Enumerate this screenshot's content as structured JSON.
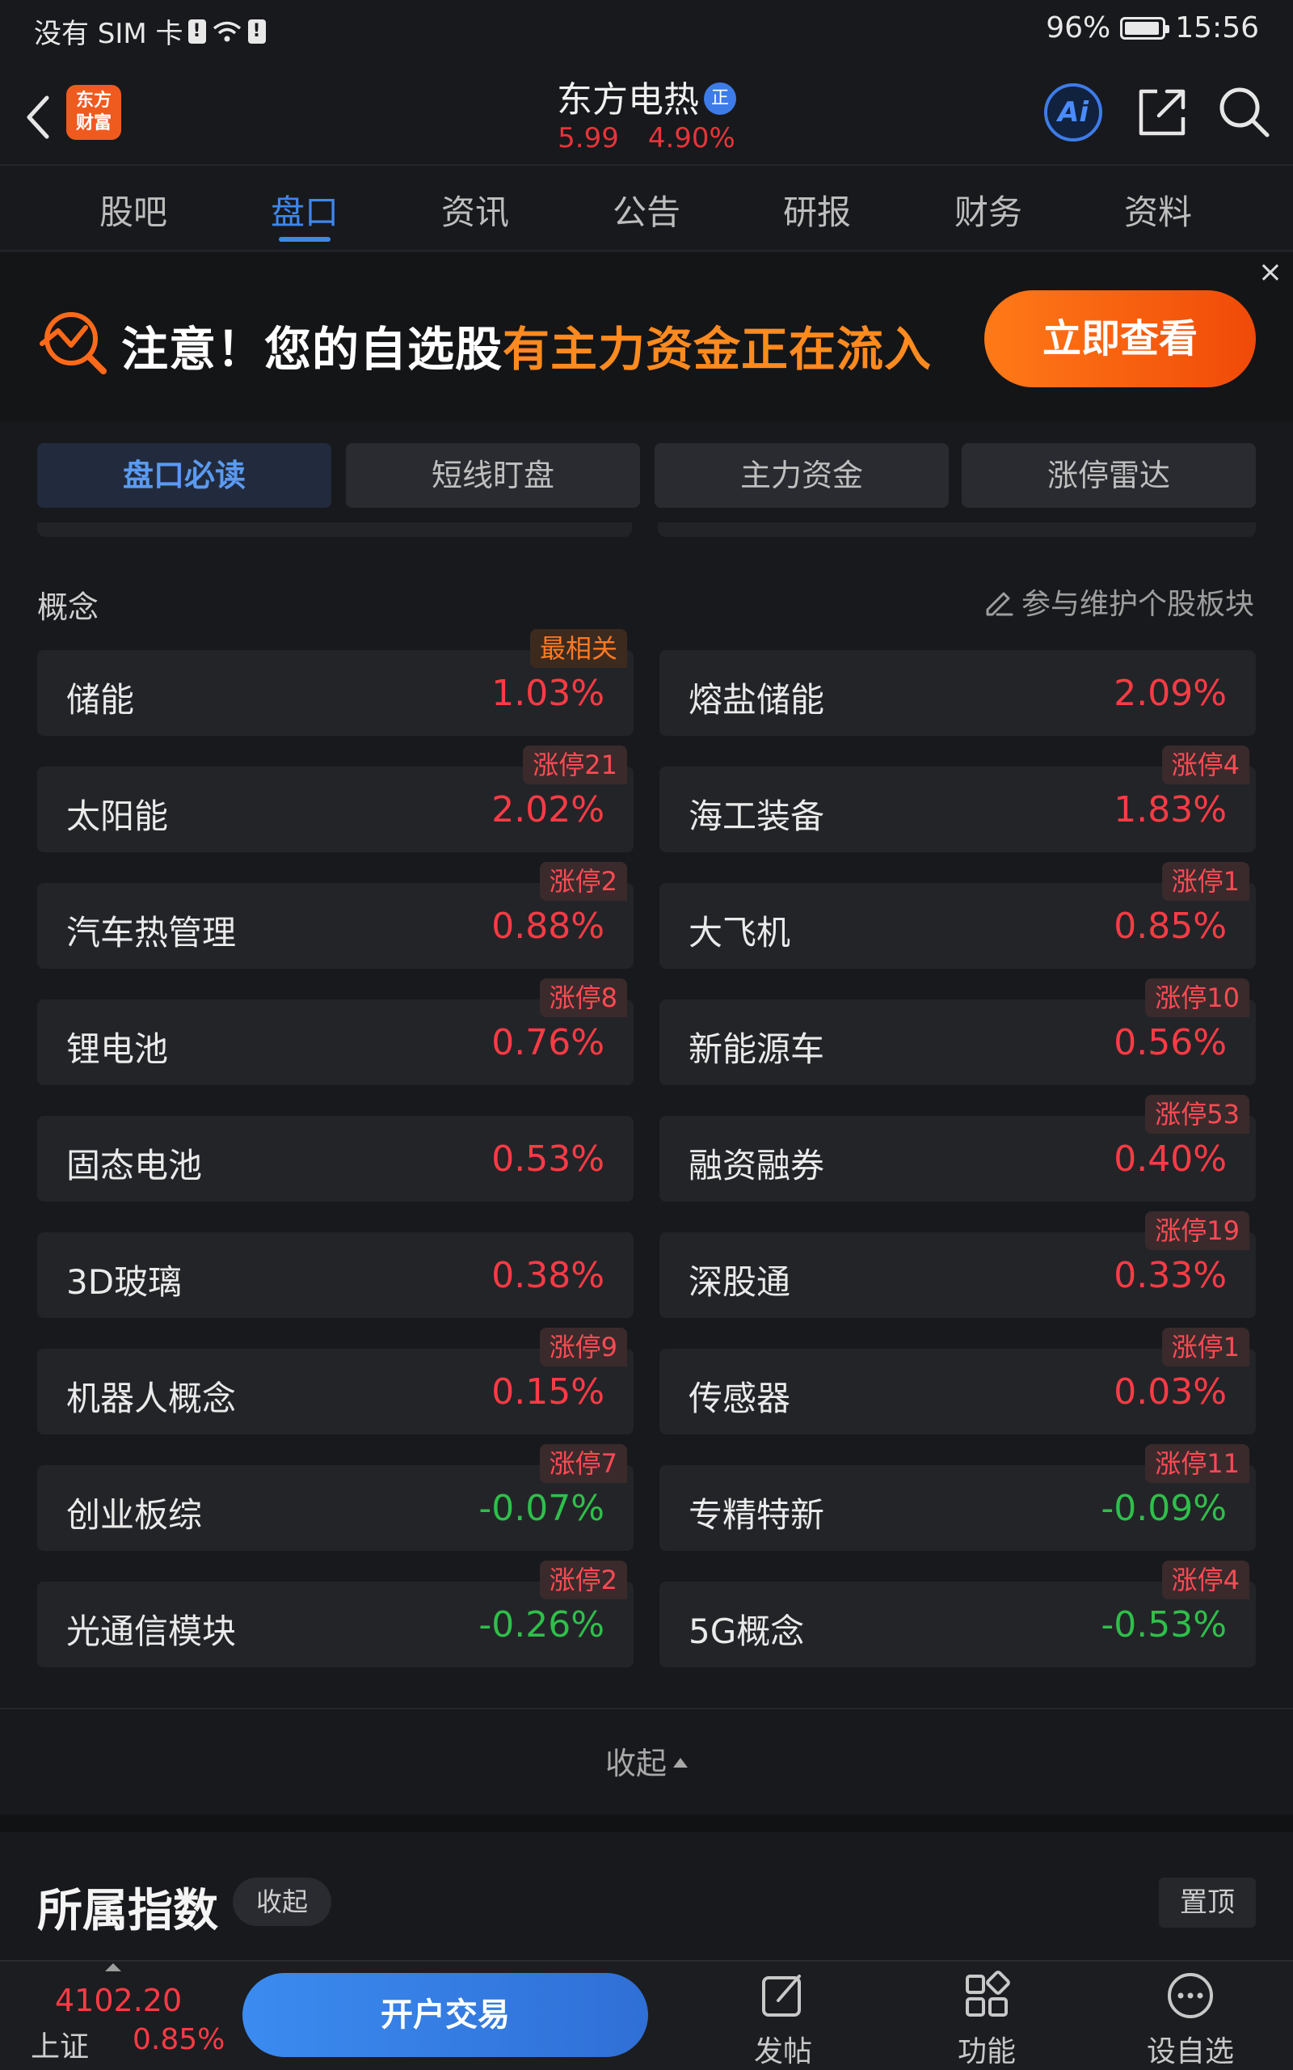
{
  "status": {
    "carrier": "没有 SIM 卡",
    "battery": "96%",
    "time": "15:56"
  },
  "header": {
    "logo_line1": "东方",
    "logo_line2": "财富",
    "stock_name": "东方电热",
    "badge": "正",
    "price": "5.99",
    "change_pct": "4.90%",
    "ai_label": "Ai"
  },
  "tabs": [
    {
      "label": "股吧"
    },
    {
      "label": "盘口"
    },
    {
      "label": "资讯"
    },
    {
      "label": "公告"
    },
    {
      "label": "研报"
    },
    {
      "label": "财务"
    },
    {
      "label": "资料"
    }
  ],
  "active_tab": "盘口",
  "banner": {
    "text_white": "注意！您的自选股",
    "text_highlight": "有主力资金正在流入",
    "button": "立即查看",
    "close": "×"
  },
  "segments": [
    {
      "label": "盘口必读"
    },
    {
      "label": "短线盯盘"
    },
    {
      "label": "主力资金"
    },
    {
      "label": "涨停雷达"
    }
  ],
  "concepts": {
    "title": "概念",
    "maintain": "参与维护个股板块",
    "items": [
      {
        "name": "储能",
        "pct": "1.03%",
        "dir": "up",
        "tag": "最相关",
        "tag_style": "orange"
      },
      {
        "name": "熔盐储能",
        "pct": "2.09%",
        "dir": "up",
        "tag": "",
        "tag_style": ""
      },
      {
        "name": "太阳能",
        "pct": "2.02%",
        "dir": "up",
        "tag": "涨停21",
        "tag_style": "red"
      },
      {
        "name": "海工装备",
        "pct": "1.83%",
        "dir": "up",
        "tag": "涨停4",
        "tag_style": "red"
      },
      {
        "name": "汽车热管理",
        "pct": "0.88%",
        "dir": "up",
        "tag": "涨停2",
        "tag_style": "red"
      },
      {
        "name": "大飞机",
        "pct": "0.85%",
        "dir": "up",
        "tag": "涨停1",
        "tag_style": "red"
      },
      {
        "name": "锂电池",
        "pct": "0.76%",
        "dir": "up",
        "tag": "涨停8",
        "tag_style": "red"
      },
      {
        "name": "新能源车",
        "pct": "0.56%",
        "dir": "up",
        "tag": "涨停10",
        "tag_style": "red"
      },
      {
        "name": "固态电池",
        "pct": "0.53%",
        "dir": "up",
        "tag": "",
        "tag_style": ""
      },
      {
        "name": "融资融券",
        "pct": "0.40%",
        "dir": "up",
        "tag": "涨停53",
        "tag_style": "red"
      },
      {
        "name": "3D玻璃",
        "pct": "0.38%",
        "dir": "up",
        "tag": "",
        "tag_style": ""
      },
      {
        "name": "深股通",
        "pct": "0.33%",
        "dir": "up",
        "tag": "涨停19",
        "tag_style": "red"
      },
      {
        "name": "机器人概念",
        "pct": "0.15%",
        "dir": "up",
        "tag": "涨停9",
        "tag_style": "red"
      },
      {
        "name": "传感器",
        "pct": "0.03%",
        "dir": "up",
        "tag": "涨停1",
        "tag_style": "red"
      },
      {
        "name": "创业板综",
        "pct": "-0.07%",
        "dir": "down",
        "tag": "涨停7",
        "tag_style": "red"
      },
      {
        "name": "专精特新",
        "pct": "-0.09%",
        "dir": "down",
        "tag": "涨停11",
        "tag_style": "red"
      },
      {
        "name": "光通信模块",
        "pct": "-0.26%",
        "dir": "down",
        "tag": "涨停2",
        "tag_style": "red"
      },
      {
        "name": "5G概念",
        "pct": "-0.53%",
        "dir": "down",
        "tag": "涨停4",
        "tag_style": "red"
      }
    ],
    "collapse": "收起"
  },
  "indices_section": {
    "title": "所属指数",
    "collapse": "收起",
    "pin": "置顶"
  },
  "bottom": {
    "index_value": "4102.20",
    "index_name": "上证",
    "index_pct": "0.85%",
    "trade": "开户交易",
    "items": [
      {
        "label": "发帖",
        "icon": "edit-icon"
      },
      {
        "label": "功能",
        "icon": "apps-icon"
      },
      {
        "label": "设自选",
        "icon": "more-icon"
      }
    ]
  },
  "colors": {
    "up": "#ff3b45",
    "down": "#2fbf4a",
    "accent": "#3f86ea",
    "banner_highlight": "#ff8a1f"
  }
}
